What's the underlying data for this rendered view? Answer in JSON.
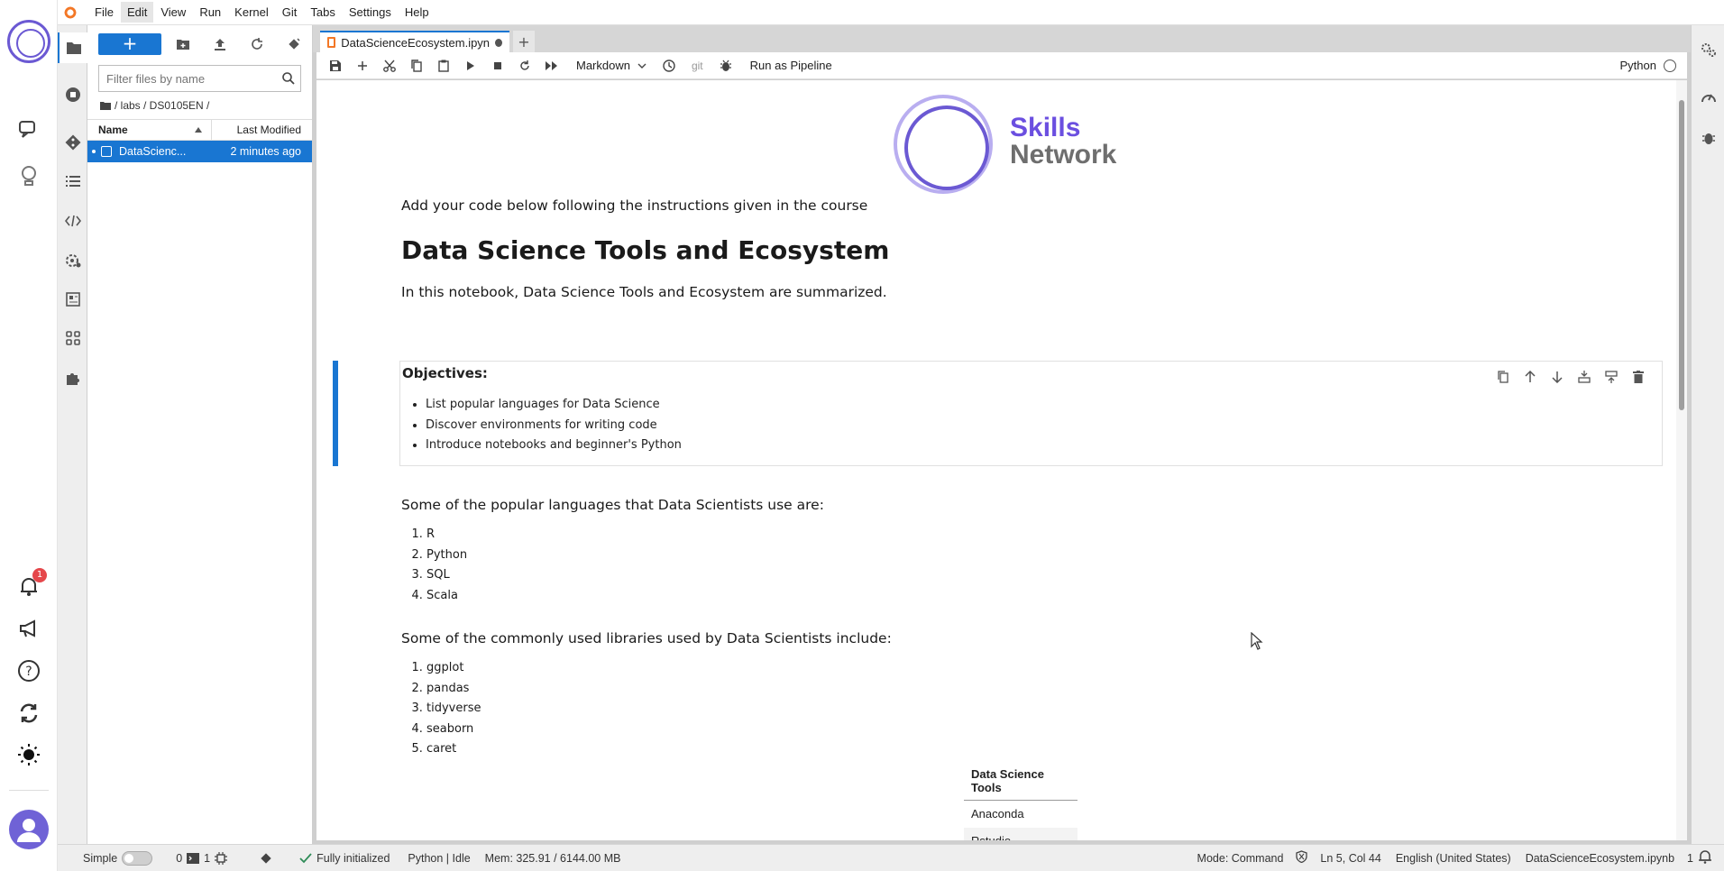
{
  "menubar": {
    "items": [
      {
        "label": "File"
      },
      {
        "label": "Edit"
      },
      {
        "label": "View"
      },
      {
        "label": "Run"
      },
      {
        "label": "Kernel"
      },
      {
        "label": "Git"
      },
      {
        "label": "Tabs"
      },
      {
        "label": "Settings"
      },
      {
        "label": "Help"
      }
    ]
  },
  "app_rail": {
    "notification_count": "1"
  },
  "filebrowser": {
    "new_label": "+",
    "search_placeholder": "Filter files by name",
    "breadcrumb": "/ labs / DS0105EN /",
    "col_name": "Name",
    "col_modified": "Last Modified",
    "files": [
      {
        "name": "DataScienc...",
        "modified": "2 minutes ago"
      }
    ]
  },
  "tabs": {
    "active_label": "DataScienceEcosystem.ipyn",
    "add_label": "+"
  },
  "toolbar": {
    "cell_type": "Markdown",
    "git_label": "git",
    "pipeline_label": "Run as Pipeline",
    "kernel_name": "Python"
  },
  "notebook": {
    "logo_line1": "Skills",
    "logo_line2": "Network",
    "intro": "Add your code below following the instructions given in the course",
    "title": "Data Science Tools and Ecosystem",
    "summary": "In this notebook, Data Science Tools and Ecosystem are summarized.",
    "objectives_heading": "Objectives:",
    "objectives": [
      "List popular languages for Data Science",
      "Discover environments for writing code",
      "Introduce notebooks and beginner's Python"
    ],
    "languages_intro": "Some of the popular languages that Data Scientists use are:",
    "languages": [
      "R",
      "Python",
      "SQL",
      "Scala"
    ],
    "libraries_intro": "Some of the commonly used libraries used by Data Scientists include:",
    "libraries": [
      "ggplot",
      "pandas",
      "tidyverse",
      "seaborn",
      "caret"
    ],
    "table_header": "Data Science Tools",
    "table_rows": [
      "Anaconda",
      "Rstudio"
    ]
  },
  "statusbar": {
    "mode_label": "Simple",
    "terminals": "0",
    "kernels": "1",
    "init": "Fully initialized",
    "kernel_status": "Python | Idle",
    "memory": "Mem: 325.91 / 6144.00 MB",
    "command_mode": "Mode: Command",
    "position": "Ln 5, Col 44",
    "language": "English (United States)",
    "filename": "DataScienceEcosystem.ipynb",
    "notif_count": "1"
  },
  "colors": {
    "accent": "#1976d2",
    "brand_purple": "#6b4fe0",
    "jupyter_orange": "#f37726"
  }
}
